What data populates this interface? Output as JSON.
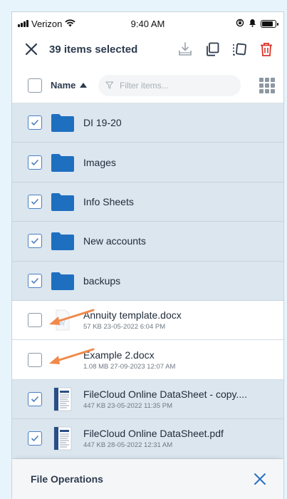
{
  "status_bar": {
    "carrier": "Verizon",
    "time": "9:40 AM"
  },
  "selection_bar": {
    "title": "39 items selected",
    "actions": [
      "download-icon",
      "copy-icon",
      "move-icon",
      "delete-icon"
    ]
  },
  "list_header": {
    "sort_label": "Name",
    "sort_direction": "ascending",
    "filter_placeholder": "Filter items..."
  },
  "items": [
    {
      "name": "DI 19-20",
      "meta": "",
      "type": "folder",
      "checked": true
    },
    {
      "name": "Images",
      "meta": "",
      "type": "folder",
      "checked": true
    },
    {
      "name": "Info Sheets",
      "meta": "",
      "type": "folder",
      "checked": true
    },
    {
      "name": "New accounts",
      "meta": "",
      "type": "folder",
      "checked": true
    },
    {
      "name": "backups",
      "meta": "",
      "type": "folder",
      "checked": true
    },
    {
      "name": "Annuity template.docx",
      "meta": "57 KB 23-05-2022 6:04 PM",
      "type": "docx",
      "checked": false
    },
    {
      "name": "Example 2.docx",
      "meta": "1.08 MB 27-09-2023 12:07 AM",
      "type": "docx",
      "checked": false
    },
    {
      "name": "FileCloud Online DataSheet - copy....",
      "meta": "447 KB 23-05-2022 11:35 PM",
      "type": "pdf",
      "checked": true
    },
    {
      "name": "FileCloud Online DataSheet.pdf",
      "meta": "447 KB 28-05-2022 12:31 AM",
      "type": "pdf",
      "checked": true
    }
  ],
  "bottom_sheet": {
    "title": "File Operations"
  },
  "colors": {
    "accent": "#4a7fc1",
    "folder": "#1f6fc0",
    "selected_row": "#dbe6ef",
    "delete": "#d9342b",
    "annotation_arrow": "#f08a4b"
  }
}
